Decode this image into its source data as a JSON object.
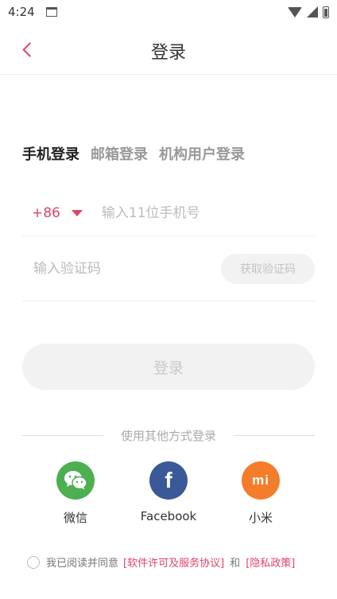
{
  "status_bar": {
    "time": "4:24"
  },
  "header": {
    "title": "登录"
  },
  "tabs": [
    {
      "label": "手机登录",
      "active": true
    },
    {
      "label": "邮箱登录",
      "active": false
    },
    {
      "label": "机构用户登录",
      "active": false
    }
  ],
  "phone": {
    "country_code": "+86",
    "placeholder": "输入11位手机号",
    "value": ""
  },
  "code": {
    "placeholder": "输入验证码",
    "value": "",
    "get_code_label": "获取验证码"
  },
  "login_button": {
    "label": "登录"
  },
  "other_login": {
    "divider_text": "使用其他方式登录",
    "providers": [
      {
        "label": "微信",
        "icon": "wechat-icon",
        "color": "#4caf50"
      },
      {
        "label": "Facebook",
        "icon": "facebook-icon",
        "color": "#3b5998"
      },
      {
        "label": "小米",
        "icon": "xiaomi-icon",
        "color": "#f57c2a"
      }
    ]
  },
  "agreement": {
    "prefix": "我已阅读并同意",
    "terms_link": "[软件许可及服务协议]",
    "conjunction": "和",
    "privacy_link": "[隐私政策]"
  },
  "colors": {
    "accent": "#e0436b"
  }
}
